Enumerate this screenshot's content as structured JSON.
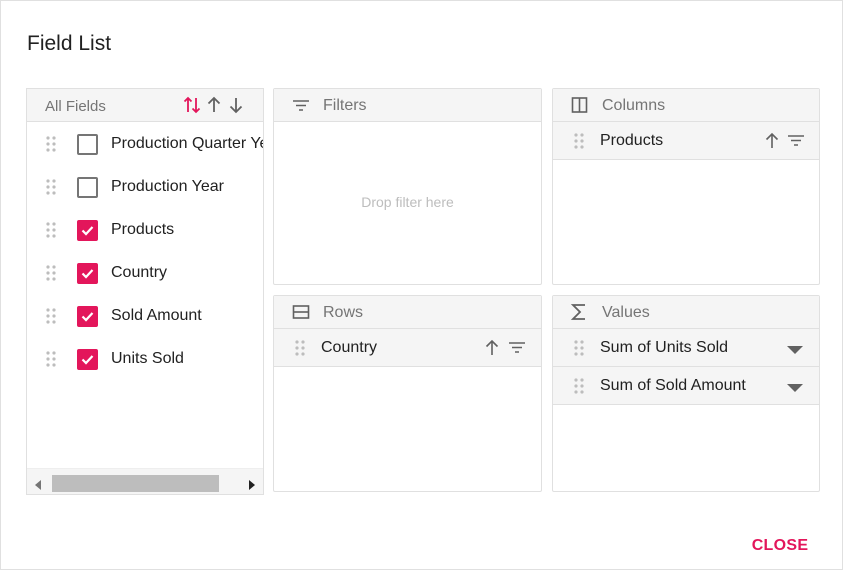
{
  "dialog": {
    "title": "Field List",
    "close_label": "CLOSE"
  },
  "colors": {
    "accent": "#e3165b",
    "header_bg": "#f5f5f5",
    "border": "#e0e0e0"
  },
  "all_fields": {
    "header": "All Fields",
    "sort_icons": [
      "sort-none-icon",
      "sort-ascending-icon",
      "sort-descending-icon"
    ],
    "items": [
      {
        "label": "Production Quarter Year",
        "checked": false
      },
      {
        "label": "Production Year",
        "checked": false
      },
      {
        "label": "Products",
        "checked": true
      },
      {
        "label": "Country",
        "checked": true
      },
      {
        "label": "Sold Amount",
        "checked": true
      },
      {
        "label": "Units Sold",
        "checked": true
      }
    ]
  },
  "filters": {
    "header": "Filters",
    "placeholder": "Drop filter here",
    "items": []
  },
  "columns": {
    "header": "Columns",
    "items": [
      {
        "label": "Products"
      }
    ]
  },
  "rows": {
    "header": "Rows",
    "items": [
      {
        "label": "Country"
      }
    ]
  },
  "values": {
    "header": "Values",
    "items": [
      {
        "label": "Sum of Units Sold"
      },
      {
        "label": "Sum of Sold Amount"
      }
    ]
  }
}
